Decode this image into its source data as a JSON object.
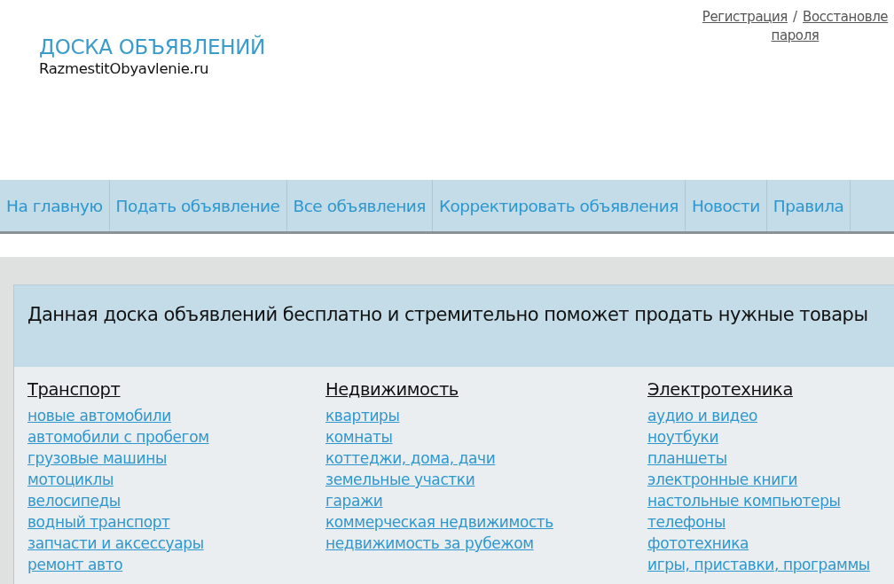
{
  "site": {
    "title": "ДОСКА ОБЪЯВЛЕНИЙ",
    "domain": "RazmestitObyavlenie.ru"
  },
  "account": {
    "register_link": "Регистрация",
    "separator": "/",
    "recover_link": {
      "line_1": "Восстановле",
      "line_2": "пароля"
    }
  },
  "nav": [
    "На главную",
    "Подать объявление",
    "Все объявления",
    "Корректировать объявления",
    "Новости",
    "Правила"
  ],
  "intro": "Данная доска объявлений бесплатно и стремительно поможет продать нужные товары",
  "categories": [
    {
      "title": "Транспорт",
      "links": [
        "новые автомобили",
        "автомобили с пробегом",
        "грузовые машины",
        "мотоциклы",
        "велосипеды",
        "водный транспорт",
        "запчасти и аксессуары",
        "ремонт авто"
      ]
    },
    {
      "title": "Недвижимость",
      "links": [
        "квартиры",
        "комнаты",
        "коттеджи, дома, дачи",
        "земельные участки",
        "гаражи",
        "коммерческая недвижимость",
        "недвижимость за рубежом"
      ]
    },
    {
      "title": "Электротехника",
      "links": [
        "аудио и видео",
        "ноутбуки",
        "планшеты",
        "электронные книги",
        "настольные компьютеры",
        "телефоны",
        "фототехника",
        "игры, приставки, программы"
      ]
    }
  ]
}
